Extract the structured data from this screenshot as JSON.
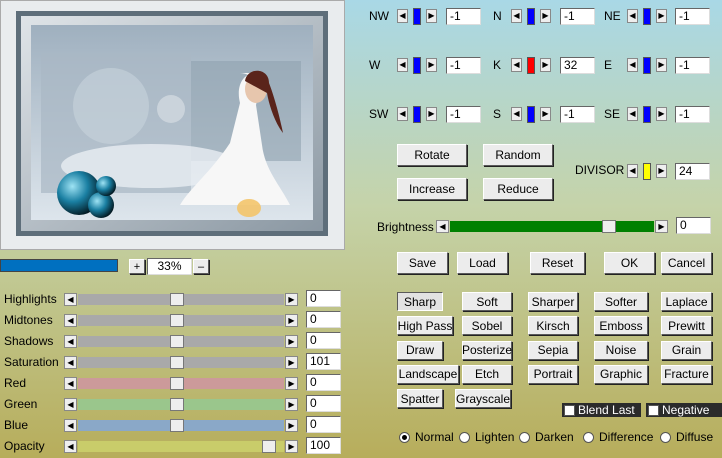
{
  "directions": [
    {
      "id": "nw",
      "label": "NW",
      "value": "-1",
      "thumb": "#0000ff"
    },
    {
      "id": "n",
      "label": "N",
      "value": "-1",
      "thumb": "#0000ff"
    },
    {
      "id": "ne",
      "label": "NE",
      "value": "-1",
      "thumb": "#0000ff"
    },
    {
      "id": "w",
      "label": "W",
      "value": "-1",
      "thumb": "#0000ff"
    },
    {
      "id": "k",
      "label": "K",
      "value": "32",
      "thumb": "#ff0000"
    },
    {
      "id": "e",
      "label": "E",
      "value": "-1",
      "thumb": "#0000ff"
    },
    {
      "id": "sw",
      "label": "SW",
      "value": "-1",
      "thumb": "#0000ff"
    },
    {
      "id": "s",
      "label": "S",
      "value": "-1",
      "thumb": "#0000ff"
    },
    {
      "id": "se",
      "label": "SE",
      "value": "-1",
      "thumb": "#0000ff"
    }
  ],
  "buttons": {
    "rotate": "Rotate",
    "random": "Random",
    "increase": "Increase",
    "reduce": "Reduce",
    "save": "Save",
    "load": "Load",
    "reset": "Reset",
    "ok": "OK",
    "cancel": "Cancel"
  },
  "divisor": {
    "label": "DIVISOR",
    "value": "24",
    "thumb": "#ffff00"
  },
  "brightness": {
    "label": "Brightness",
    "value": "0",
    "level": 0.8
  },
  "zoom": {
    "value": "33%",
    "plus": "+",
    "minus": "–"
  },
  "sliders": [
    {
      "label": "Highlights",
      "value": "0",
      "level": 0.48,
      "track": "#a9a9a9"
    },
    {
      "label": "Midtones",
      "value": "0",
      "level": 0.48,
      "track": "#a9a9a9"
    },
    {
      "label": "Shadows",
      "value": "0",
      "level": 0.48,
      "track": "#a9a9a9"
    },
    {
      "label": "Saturation",
      "value": "101",
      "level": 0.48,
      "track": "#a9a9a9"
    },
    {
      "label": "Red",
      "value": "0",
      "level": 0.48,
      "track": "#cc9a9a"
    },
    {
      "label": "Green",
      "value": "0",
      "level": 0.48,
      "track": "#9ac68c"
    },
    {
      "label": "Blue",
      "value": "0",
      "level": 0.48,
      "track": "#8aa8c8"
    },
    {
      "label": "Opacity",
      "value": "100",
      "level": 0.96,
      "track": "#c9cc6a"
    }
  ],
  "presets": [
    [
      "Sharp",
      "Soft",
      "Sharper",
      "Softer",
      "Laplace"
    ],
    [
      "High Pass",
      "Sobel",
      "Kirsch",
      "Emboss",
      "Prewitt"
    ],
    [
      "Draw",
      "Posterize",
      "Sepia",
      "Noise",
      "Grain"
    ],
    [
      "Landscape",
      "Etch",
      "Portrait",
      "Graphic",
      "Fracture"
    ],
    [
      "Spatter",
      "Grayscale"
    ]
  ],
  "checks": {
    "blend_last": "Blend Last",
    "negative": "Negative"
  },
  "modes": [
    "Normal",
    "Lighten",
    "Darken",
    "Difference",
    "Diffuse"
  ],
  "colors": {
    "accent": "#0070c0",
    "brightness_track": "#008000"
  }
}
